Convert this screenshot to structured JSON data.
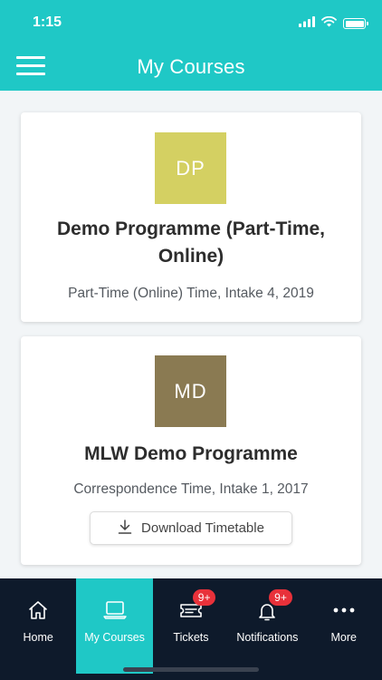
{
  "status_bar": {
    "time": "1:15"
  },
  "header": {
    "title": "My Courses"
  },
  "courses": [
    {
      "initials": "DP",
      "color": "#d4d062",
      "title": "Demo Programme (Part-Time, Online)",
      "subtitle": "Part-Time (Online) Time, Intake 4, 2019"
    },
    {
      "initials": "MD",
      "color": "#8a7a52",
      "title": "MLW Demo Programme",
      "subtitle": "Correspondence Time, Intake 1, 2017",
      "download_label": "Download Timetable"
    }
  ],
  "tabbar": {
    "active_tab": "My Courses",
    "accent": "#1fc8c6",
    "background": "#0e1a2b",
    "items": [
      {
        "label": "Home",
        "icon": "home-icon"
      },
      {
        "label": "My Courses",
        "icon": "laptop-icon"
      },
      {
        "label": "Tickets",
        "icon": "ticket-icon",
        "badge": "9+"
      },
      {
        "label": "Notifications",
        "icon": "bell-icon",
        "badge": "9+"
      },
      {
        "label": "More",
        "icon": "more-dots-icon"
      }
    ]
  }
}
